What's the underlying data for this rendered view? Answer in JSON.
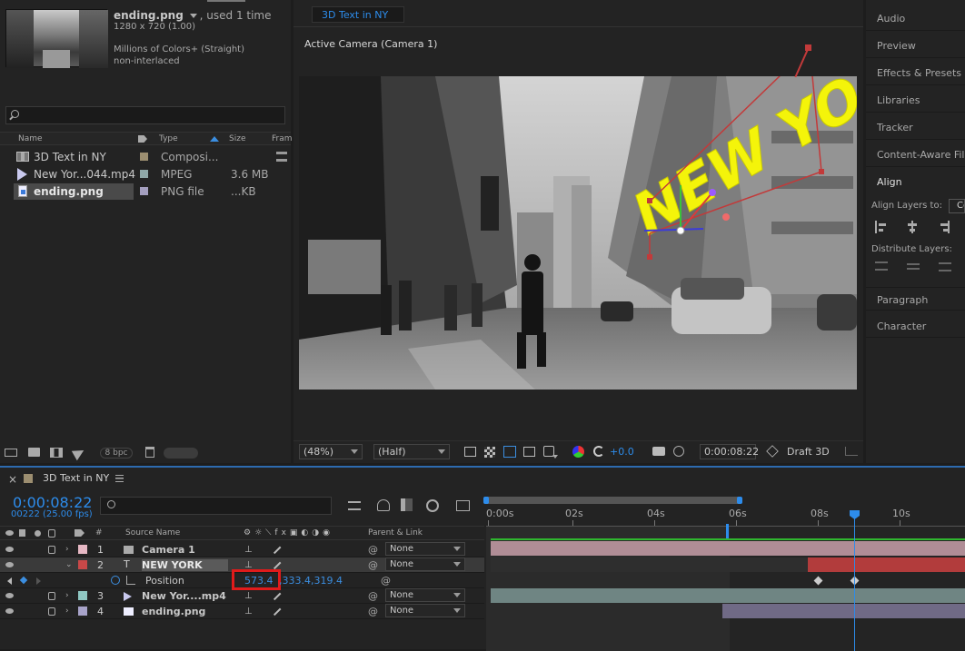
{
  "project": {
    "asset_name": "ending.png",
    "asset_used": ", used 1 time",
    "asset_dims": "1280 x 720 (1.00)",
    "asset_colors": "Millions of Colors+ (Straight)",
    "asset_interlace": "non-interlaced",
    "search_placeholder": "",
    "columns": {
      "name": "Name",
      "type": "Type",
      "size": "Size",
      "frame": "Fram"
    },
    "items": [
      {
        "name": "3D Text in NY",
        "type": "Composi...",
        "size": "",
        "color": "#9c8e70"
      },
      {
        "name": "New Yor...044.mp4",
        "type": "MPEG",
        "size": "3.6 MB",
        "color": "#8fa7a7"
      },
      {
        "name": "ending.png",
        "type": "PNG file",
        "size": "...KB",
        "color": "#a49fbf"
      }
    ],
    "bpc": "8 bpc"
  },
  "viewer": {
    "tab": "3D Text in NY",
    "camera_label": "Active Camera (Camera 1)",
    "overlay_text": "NEW YORK",
    "zoom": "(48%)",
    "resolution": "(Half)",
    "exposure": "+0.0",
    "timecode": "0:00:08:22",
    "renderer": "Draft 3D"
  },
  "right_panels": {
    "items": [
      "Audio",
      "Preview",
      "Effects & Presets",
      "Libraries",
      "Tracker",
      "Content-Aware Fill",
      "Align"
    ],
    "align_to_label": "Align Layers to:",
    "align_to_value": "Co",
    "distribute_label": "Distribute Layers:",
    "bottom_items": [
      "Paragraph",
      "Character"
    ]
  },
  "timeline": {
    "comp_tab": "3D Text in NY",
    "timecode": "0:00:08:22",
    "frames": "00222 (25.00 fps)",
    "search_placeholder": "",
    "col_hash": "#",
    "col_source": "Source Name",
    "col_parent": "Parent & Link",
    "ruler": [
      "0:00s",
      "02s",
      "04s",
      "06s",
      "08s",
      "10s"
    ],
    "layers": [
      {
        "num": "1",
        "name": "Camera 1",
        "parent": "None",
        "color": "#e6b8c4"
      },
      {
        "num": "2",
        "name": "NEW YORK",
        "parent": "None",
        "color": "#c94848"
      },
      {
        "num": "3",
        "name": "New Yor....mp4",
        "parent": "None",
        "color": "#8fc7c2"
      },
      {
        "num": "4",
        "name": "ending.png",
        "parent": "None",
        "color": "#a8a3c9"
      }
    ],
    "position_label": "Position",
    "position_x": "573.4",
    "position_rest": ",333.4,319.4"
  }
}
